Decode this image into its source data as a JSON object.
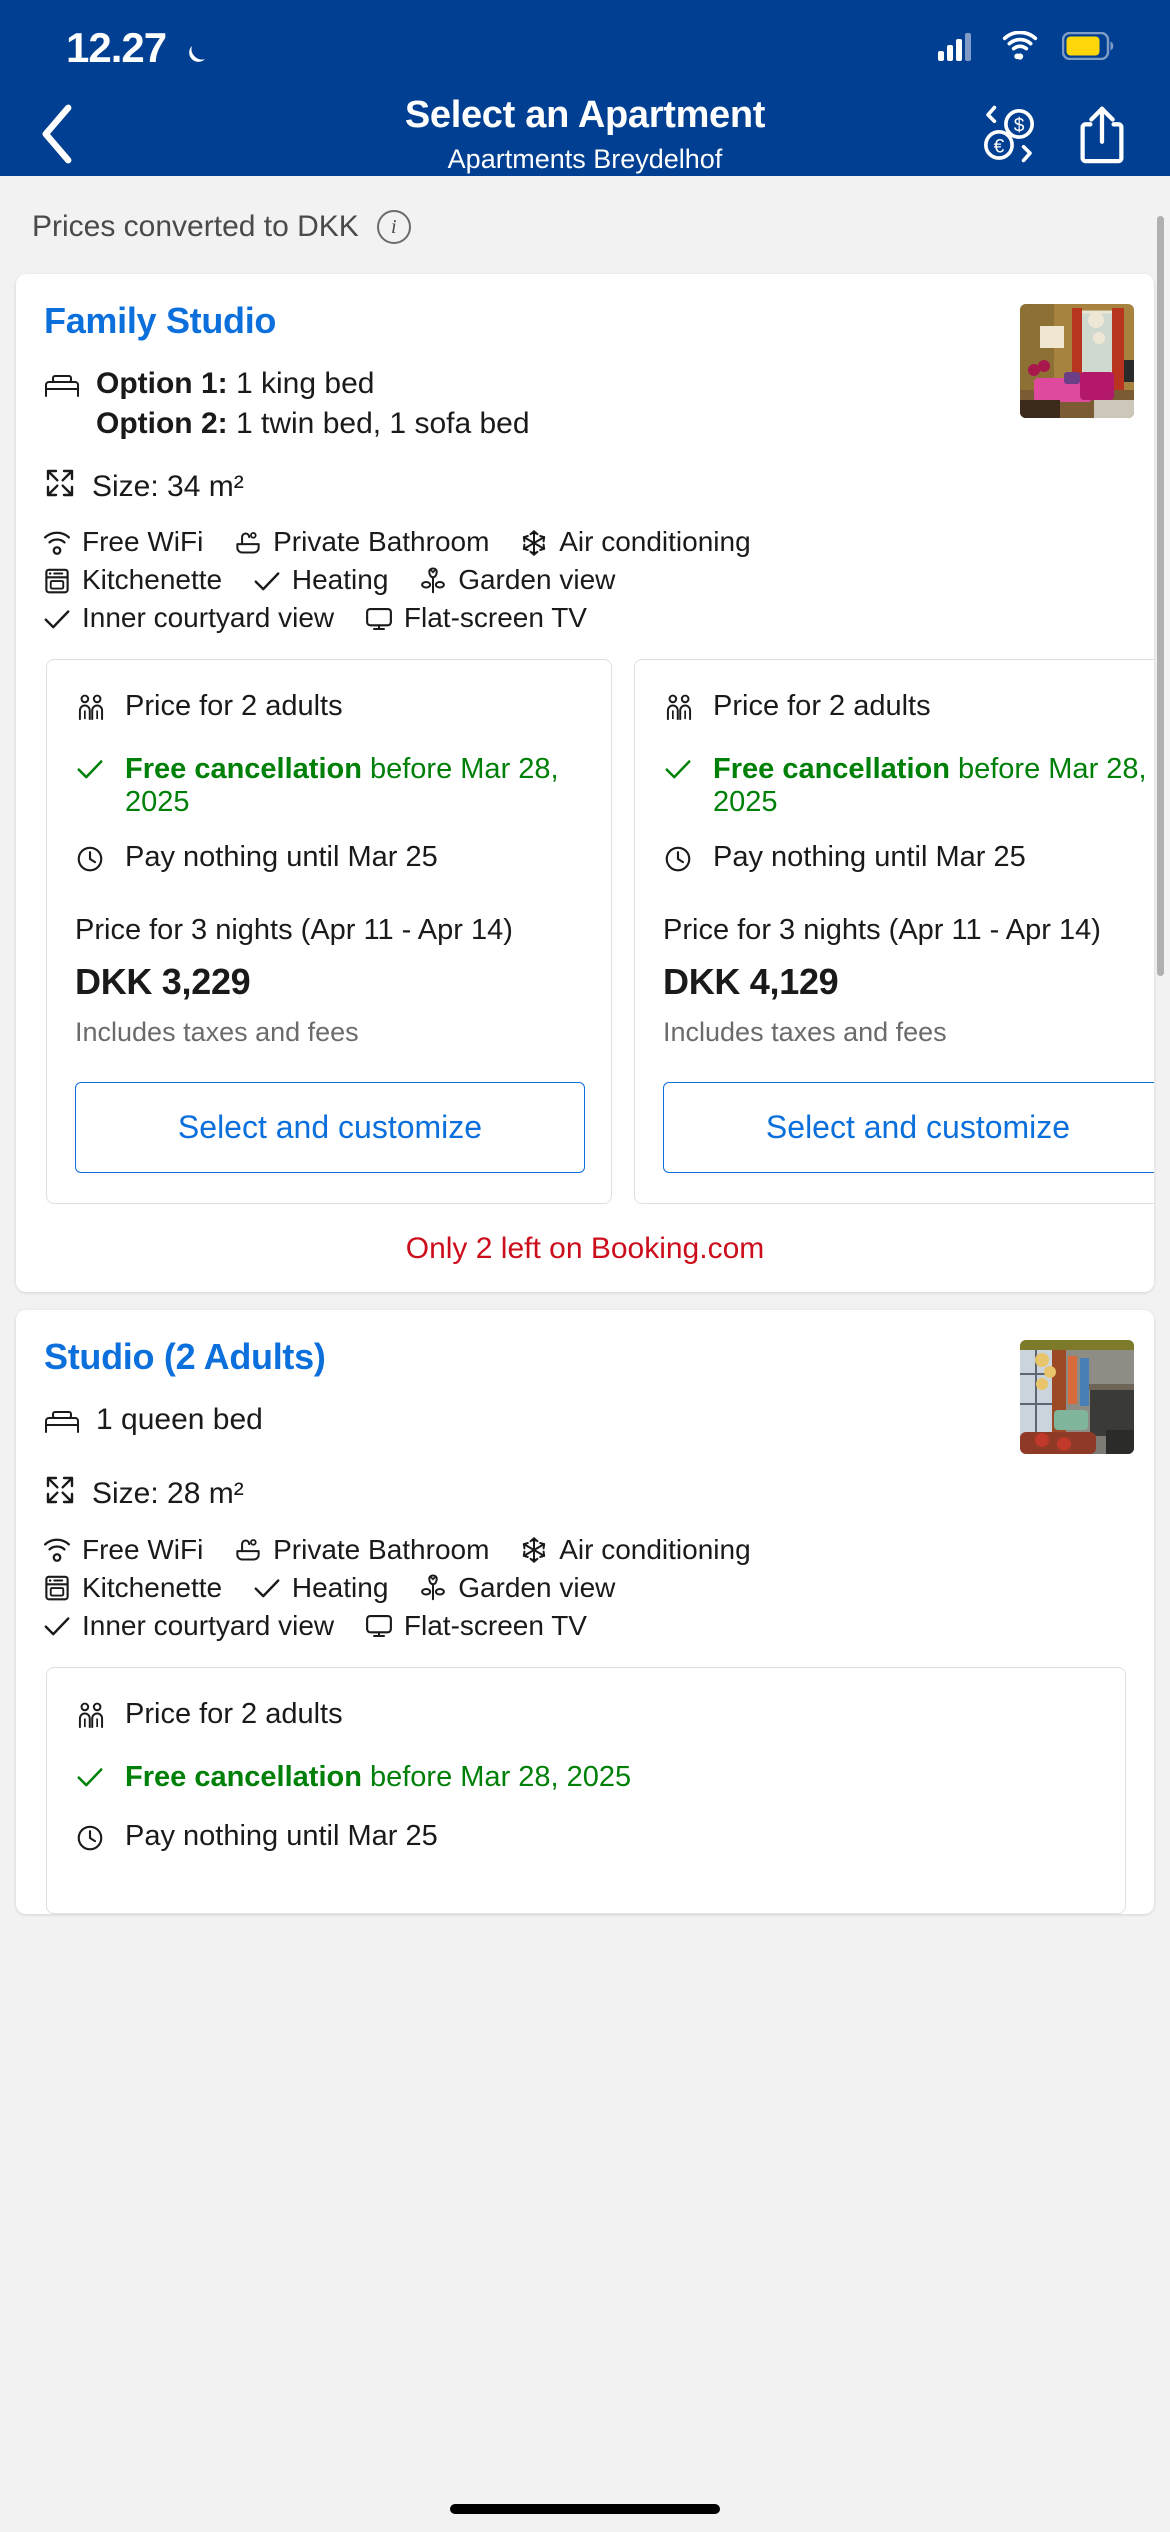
{
  "status_bar": {
    "time": "12.27",
    "moon_icon": "crescent-moon-icon",
    "signal_icon": "cellular-signal-icon",
    "wifi_icon": "wifi-icon",
    "battery_icon": "battery-icon",
    "battery_color": "#ffd60a"
  },
  "nav": {
    "back_icon": "chevron-left-icon",
    "title": "Select an Apartment",
    "subtitle": "Apartments Breydelhof",
    "currency_icon": "currency-exchange-icon",
    "share_icon": "share-icon",
    "brand_color": "#003f91"
  },
  "converted": {
    "text": "Prices converted to DKK",
    "info_icon": "info-icon",
    "info_glyph": "i"
  },
  "rooms": [
    {
      "title": "Family Studio",
      "bed_icon": "bed-icon",
      "bed_options": [
        {
          "label": "Option 1:",
          "value": "1 king bed"
        },
        {
          "label": "Option 2:",
          "value": "1 twin bed, 1 sofa bed"
        }
      ],
      "size_icon": "resize-icon",
      "size": "Size: 34 m²",
      "amenities": [
        {
          "icon": "wifi-icon",
          "label": "Free WiFi"
        },
        {
          "icon": "bathtub-icon",
          "label": "Private Bathroom"
        },
        {
          "icon": "snowflake-icon",
          "label": "Air conditioning"
        },
        {
          "icon": "oven-icon",
          "label": "Kitchenette"
        },
        {
          "icon": "check-icon",
          "label": "Heating"
        },
        {
          "icon": "flower-icon",
          "label": "Garden view"
        },
        {
          "icon": "check-icon",
          "label": "Inner courtyard view"
        },
        {
          "icon": "tv-icon",
          "label": "Flat-screen TV"
        }
      ],
      "price_boxes": [
        {
          "occupancy_icon": "two-people-icon",
          "occupancy": "Price for 2 adults",
          "check_icon": "check-icon",
          "cancellation_strong": "Free cancellation",
          "cancellation_rest": " before Mar 28, 2025",
          "clock_icon": "clock-icon",
          "pay_later": "Pay nothing until Mar 25",
          "nights_label": "Price for 3 nights (Apr 11 - Apr 14)",
          "price": "DKK 3,229",
          "taxes": "Includes taxes and fees",
          "button": "Select and customize"
        },
        {
          "occupancy_icon": "two-people-icon",
          "occupancy": "Price for 2 adults",
          "check_icon": "check-icon",
          "cancellation_strong": "Free cancellation",
          "cancellation_rest": " before Mar 28, 2025",
          "clock_icon": "clock-icon",
          "pay_later": "Pay nothing until Mar 25",
          "nights_label": "Price for 3 nights (Apr 11 - Apr 14)",
          "price": "DKK 4,129",
          "taxes": "Includes taxes and fees",
          "button": "Select and customize"
        }
      ],
      "availability_warning": "Only 2 left on Booking.com"
    },
    {
      "title": "Studio (2 Adults)",
      "bed_icon": "bed-icon",
      "bed_options": [
        {
          "label": "",
          "value": "1 queen bed"
        }
      ],
      "size_icon": "resize-icon",
      "size": "Size: 28 m²",
      "amenities": [
        {
          "icon": "wifi-icon",
          "label": "Free WiFi"
        },
        {
          "icon": "bathtub-icon",
          "label": "Private Bathroom"
        },
        {
          "icon": "snowflake-icon",
          "label": "Air conditioning"
        },
        {
          "icon": "oven-icon",
          "label": "Kitchenette"
        },
        {
          "icon": "check-icon",
          "label": "Heating"
        },
        {
          "icon": "flower-icon",
          "label": "Garden view"
        },
        {
          "icon": "check-icon",
          "label": "Inner courtyard view"
        },
        {
          "icon": "tv-icon",
          "label": "Flat-screen TV"
        }
      ],
      "price_boxes": [
        {
          "occupancy_icon": "two-people-icon",
          "occupancy": "Price for 2 adults",
          "check_icon": "check-icon",
          "cancellation_strong": "Free cancellation",
          "cancellation_rest": " before Mar 28, 2025",
          "clock_icon": "clock-icon",
          "pay_later": "Pay nothing until Mar 25",
          "nights_label": "",
          "price": "",
          "taxes": "",
          "button": ""
        }
      ],
      "availability_warning": ""
    }
  ],
  "colors": {
    "brand_blue": "#003f91",
    "link_blue": "#0b6fdc",
    "green": "#008009",
    "red": "#cc0d1b",
    "grey_text": "#6b6b6b"
  }
}
